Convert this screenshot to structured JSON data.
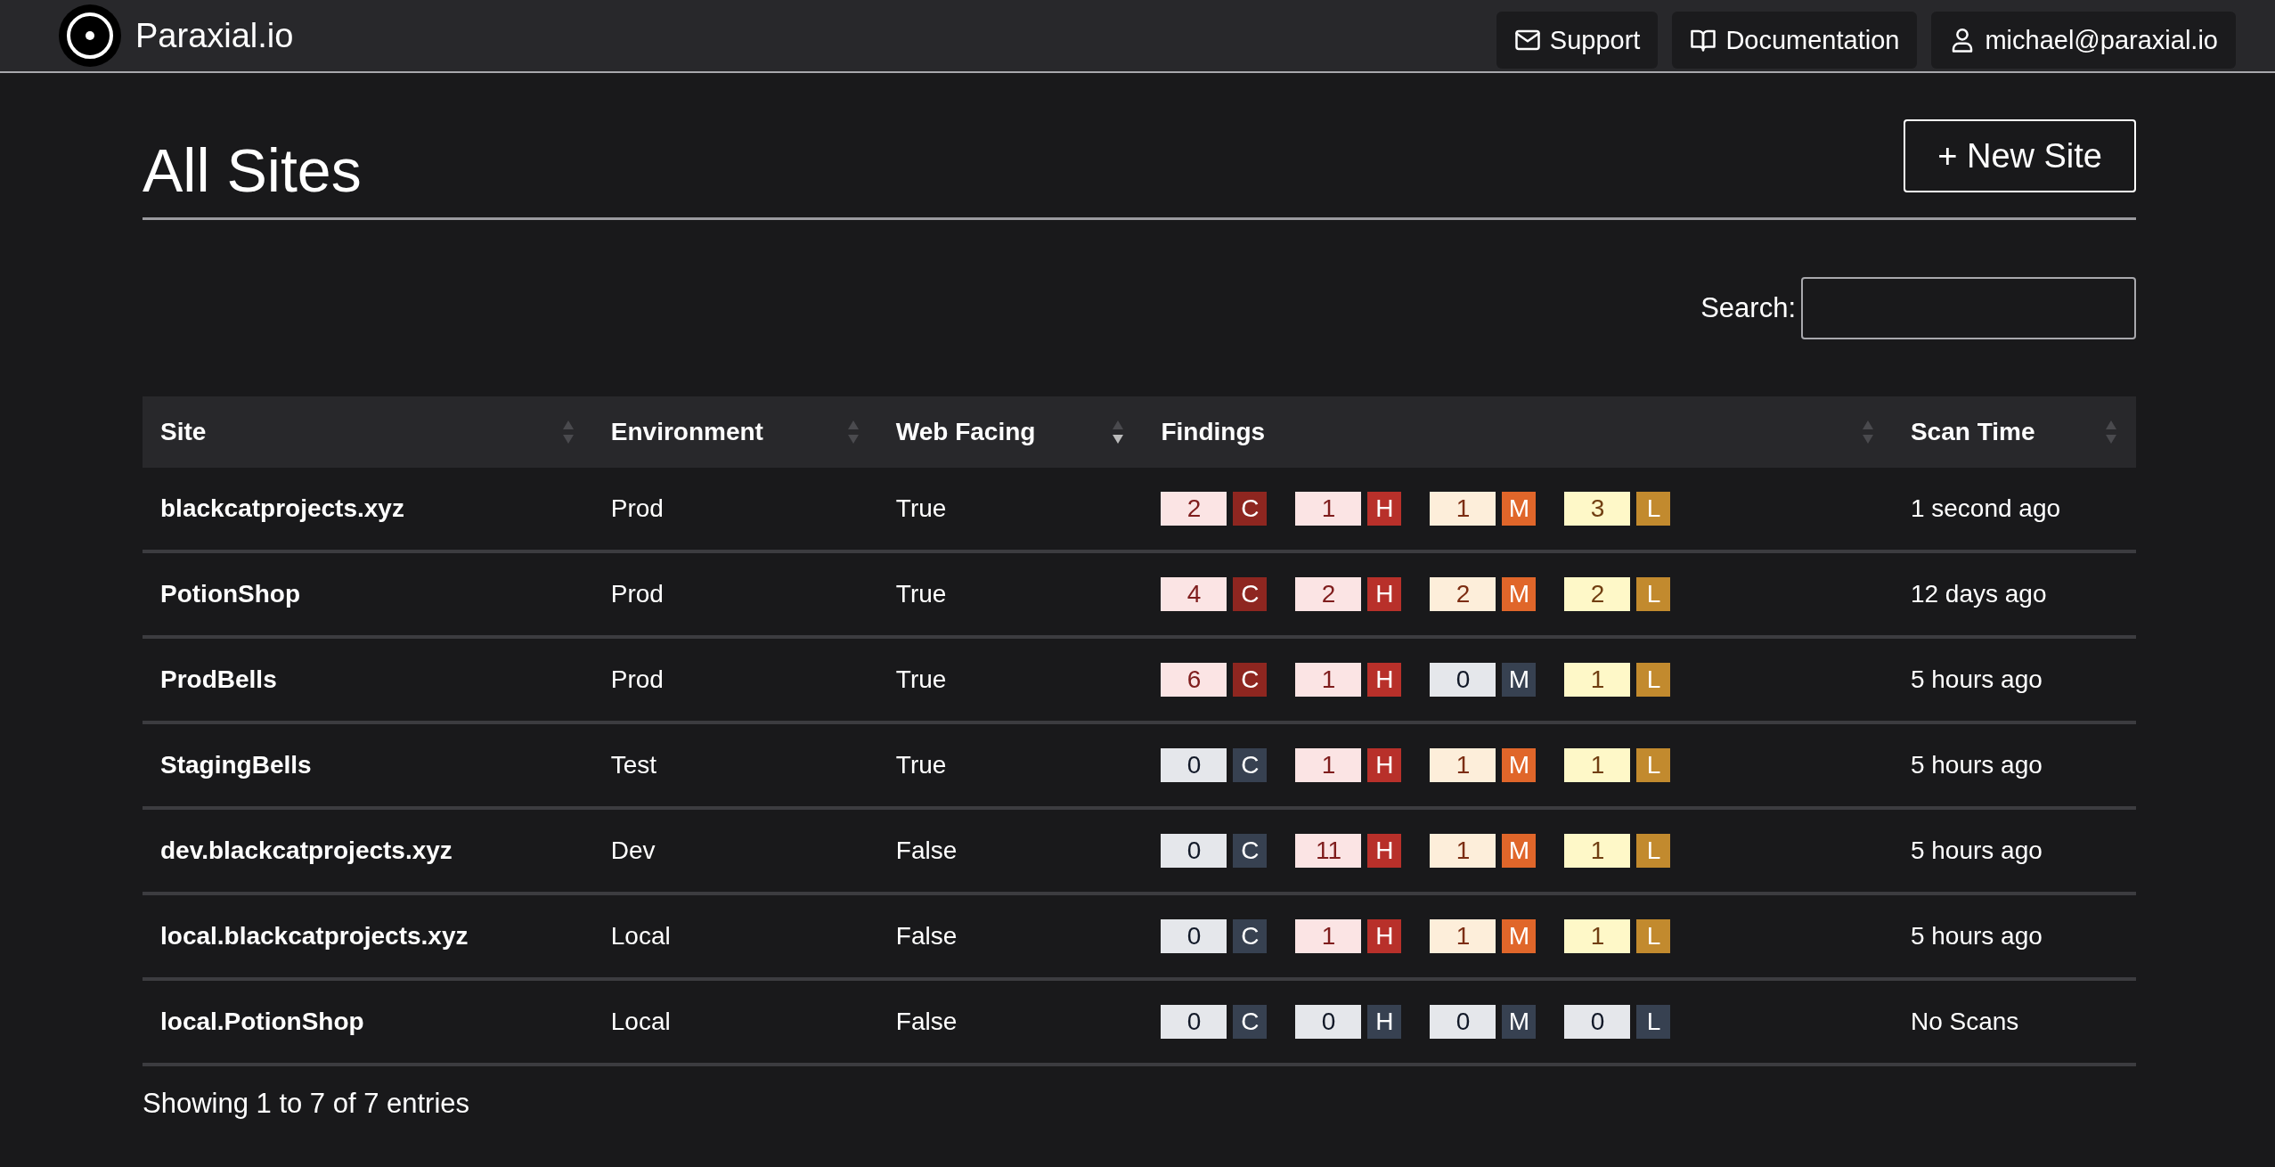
{
  "navbar": {
    "brand": "Paraxial.io",
    "links": [
      {
        "kind": "mail",
        "label": "Support"
      },
      {
        "kind": "book",
        "label": "Documentation"
      },
      {
        "kind": "user",
        "label": "michael@paraxial.io"
      }
    ]
  },
  "page": {
    "title": "All Sites",
    "new_button": "+ New Site"
  },
  "search": {
    "label": "Search:"
  },
  "table": {
    "columns": [
      {
        "label": "Site",
        "sorted_descending": false
      },
      {
        "label": "Environment",
        "sorted_descending": false
      },
      {
        "label": "Web Facing",
        "sorted_descending": true
      },
      {
        "label": "Findings",
        "sorted_descending": false
      },
      {
        "label": "Scan Time",
        "sorted_descending": false
      }
    ],
    "rows": [
      {
        "site": "blackcatprojects.xyz",
        "environment": "Prod",
        "web_facing": "True",
        "findings": [
          {
            "count": "2",
            "letter": "C",
            "kind": "critical"
          },
          {
            "count": "1",
            "letter": "H",
            "kind": "high"
          },
          {
            "count": "1",
            "letter": "M",
            "kind": "medium"
          },
          {
            "count": "3",
            "letter": "L",
            "kind": "low"
          }
        ],
        "scan_time": "1 second ago"
      },
      {
        "site": "PotionShop",
        "environment": "Prod",
        "web_facing": "True",
        "findings": [
          {
            "count": "4",
            "letter": "C",
            "kind": "critical"
          },
          {
            "count": "2",
            "letter": "H",
            "kind": "high"
          },
          {
            "count": "2",
            "letter": "M",
            "kind": "medium"
          },
          {
            "count": "2",
            "letter": "L",
            "kind": "low"
          }
        ],
        "scan_time": "12 days ago"
      },
      {
        "site": "ProdBells",
        "environment": "Prod",
        "web_facing": "True",
        "findings": [
          {
            "count": "6",
            "letter": "C",
            "kind": "critical"
          },
          {
            "count": "1",
            "letter": "H",
            "kind": "high"
          },
          {
            "count": "0",
            "letter": "M",
            "kind": "none"
          },
          {
            "count": "1",
            "letter": "L",
            "kind": "low"
          }
        ],
        "scan_time": "5 hours ago"
      },
      {
        "site": "StagingBells",
        "environment": "Test",
        "web_facing": "True",
        "findings": [
          {
            "count": "0",
            "letter": "C",
            "kind": "none"
          },
          {
            "count": "1",
            "letter": "H",
            "kind": "high"
          },
          {
            "count": "1",
            "letter": "M",
            "kind": "medium"
          },
          {
            "count": "1",
            "letter": "L",
            "kind": "low"
          }
        ],
        "scan_time": "5 hours ago"
      },
      {
        "site": "dev.blackcatprojects.xyz",
        "environment": "Dev",
        "web_facing": "False",
        "findings": [
          {
            "count": "0",
            "letter": "C",
            "kind": "none"
          },
          {
            "count": "11",
            "letter": "H",
            "kind": "high"
          },
          {
            "count": "1",
            "letter": "M",
            "kind": "medium"
          },
          {
            "count": "1",
            "letter": "L",
            "kind": "low"
          }
        ],
        "scan_time": "5 hours ago"
      },
      {
        "site": "local.blackcatprojects.xyz",
        "environment": "Local",
        "web_facing": "False",
        "findings": [
          {
            "count": "0",
            "letter": "C",
            "kind": "none"
          },
          {
            "count": "1",
            "letter": "H",
            "kind": "high"
          },
          {
            "count": "1",
            "letter": "M",
            "kind": "medium"
          },
          {
            "count": "1",
            "letter": "L",
            "kind": "low"
          }
        ],
        "scan_time": "5 hours ago"
      },
      {
        "site": "local.PotionShop",
        "environment": "Local",
        "web_facing": "False",
        "findings": [
          {
            "count": "0",
            "letter": "C",
            "kind": "none"
          },
          {
            "count": "0",
            "letter": "H",
            "kind": "none"
          },
          {
            "count": "0",
            "letter": "M",
            "kind": "none"
          },
          {
            "count": "0",
            "letter": "L",
            "kind": "none"
          }
        ],
        "scan_time": "No Scans"
      }
    ]
  },
  "footer": {
    "info": "Showing 1 to 7 of 7 entries"
  }
}
